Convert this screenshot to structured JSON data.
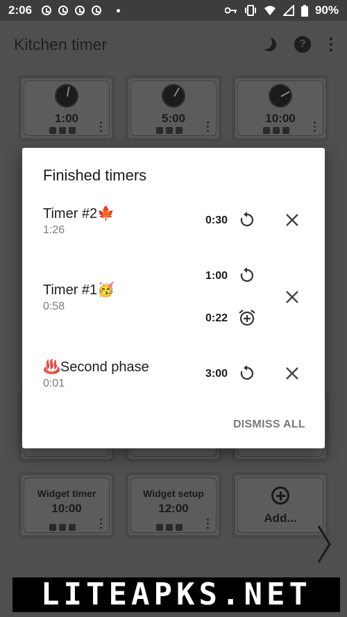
{
  "status_bar": {
    "time": "2:06",
    "battery": "90%"
  },
  "app_bar": {
    "title": "Kitchen timer"
  },
  "tiles": {
    "t1": {
      "time": "1:00"
    },
    "t2": {
      "time": "5:00"
    },
    "t3": {
      "time": "10:00"
    },
    "widget_timer": {
      "label": "Widget timer",
      "time": "10:00"
    },
    "widget_setup": {
      "label": "Widget setup",
      "time": "12:00"
    },
    "add": {
      "label": "Add..."
    }
  },
  "dialog": {
    "title": "Finished timers",
    "rows": [
      {
        "name": "Timer #2🍁",
        "elapsed": "1:26",
        "time": "0:30"
      },
      {
        "name": "Timer #1🥳",
        "elapsed": "0:58",
        "time_a": "1:00",
        "time_b": "0:22"
      },
      {
        "name": "♨️Second phase",
        "elapsed": "0:01",
        "time": "3:00"
      }
    ],
    "dismiss_all": "DISMISS ALL"
  },
  "watermark": "LITEAPKS.NET"
}
